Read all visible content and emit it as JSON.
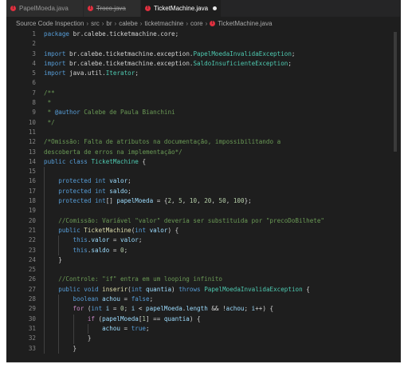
{
  "tabs": [
    {
      "label": "PapelMoeda.java",
      "active": false,
      "error": true,
      "deleted": false,
      "dirty": false
    },
    {
      "label": "Troco.java",
      "active": false,
      "error": true,
      "deleted": true,
      "dirty": false
    },
    {
      "label": "TicketMachine.java",
      "active": true,
      "error": true,
      "deleted": false,
      "dirty": true
    }
  ],
  "breadcrumb": [
    "Source Code Inspection",
    "src",
    "br",
    "calebe",
    "ticketmachine",
    "core",
    "TicketMachine.java"
  ],
  "colors": {
    "error": "#e0303f",
    "keyword": "#569cd6",
    "type": "#4ec9b0",
    "comment": "#6a9955",
    "number": "#b5cea8",
    "variable": "#9cdcfe"
  },
  "editor": {
    "lines": [
      {
        "n": "1",
        "i": 0,
        "t": [
          [
            "kw",
            "package "
          ],
          [
            "pl",
            "br.calebe.ticketmachine.core;"
          ]
        ]
      },
      {
        "n": "2",
        "i": 0,
        "t": []
      },
      {
        "n": "3",
        "i": 0,
        "t": [
          [
            "kw",
            "import "
          ],
          [
            "pl",
            "br.calebe.ticketmachine.exception."
          ],
          [
            "ty",
            "PapelMoedaInvalidaException"
          ],
          [
            "pl",
            ";"
          ]
        ]
      },
      {
        "n": "4",
        "i": 0,
        "t": [
          [
            "kw",
            "import "
          ],
          [
            "pl",
            "br.calebe.ticketmachine.exception."
          ],
          [
            "ty",
            "SaldoInsuficienteException"
          ],
          [
            "pl",
            ";"
          ]
        ]
      },
      {
        "n": "5",
        "i": 0,
        "t": [
          [
            "kw",
            "import "
          ],
          [
            "pl",
            "java.util."
          ],
          [
            "ty",
            "Iterator"
          ],
          [
            "pl",
            ";"
          ]
        ]
      },
      {
        "n": "6",
        "i": 0,
        "t": []
      },
      {
        "n": "7",
        "i": 0,
        "t": [
          [
            "cm",
            "/**"
          ]
        ]
      },
      {
        "n": "8",
        "i": 0,
        "t": [
          [
            "cm",
            " *"
          ]
        ]
      },
      {
        "n": "9",
        "i": 0,
        "t": [
          [
            "cm",
            " * "
          ],
          [
            "tag",
            "@author"
          ],
          [
            "cm",
            " Calebe de Paula Bianchini"
          ]
        ]
      },
      {
        "n": "10",
        "i": 0,
        "t": [
          [
            "cm",
            " */"
          ]
        ]
      },
      {
        "n": "11",
        "i": 0,
        "t": []
      },
      {
        "n": "12",
        "i": 0,
        "t": [
          [
            "cm",
            "/*Omissão: Falta de atributos na documentação, impossibilitando a"
          ]
        ]
      },
      {
        "n": "13",
        "i": 0,
        "t": [
          [
            "cm",
            "descoberta de erros na implementação*/"
          ]
        ]
      },
      {
        "n": "14",
        "i": 0,
        "t": [
          [
            "kw",
            "public class "
          ],
          [
            "ty",
            "TicketMachine"
          ],
          [
            "pl",
            " {"
          ]
        ]
      },
      {
        "n": "15",
        "i": 1,
        "t": []
      },
      {
        "n": "16",
        "i": 1,
        "t": [
          [
            "kw",
            "protected int "
          ],
          [
            "var",
            "valor"
          ],
          [
            "pl",
            ";"
          ]
        ]
      },
      {
        "n": "17",
        "i": 1,
        "t": [
          [
            "kw",
            "protected int "
          ],
          [
            "var",
            "saldo"
          ],
          [
            "pl",
            ";"
          ]
        ]
      },
      {
        "n": "18",
        "i": 1,
        "t": [
          [
            "kw",
            "protected int"
          ],
          [
            "pl",
            "[] "
          ],
          [
            "var",
            "papelMoeda"
          ],
          [
            "pl",
            " = {"
          ],
          [
            "num",
            "2"
          ],
          [
            "pl",
            ", "
          ],
          [
            "num",
            "5"
          ],
          [
            "pl",
            ", "
          ],
          [
            "num",
            "10"
          ],
          [
            "pl",
            ", "
          ],
          [
            "num",
            "20"
          ],
          [
            "pl",
            ", "
          ],
          [
            "num",
            "50"
          ],
          [
            "pl",
            ", "
          ],
          [
            "num",
            "100"
          ],
          [
            "pl",
            "};"
          ]
        ]
      },
      {
        "n": "19",
        "i": 1,
        "t": []
      },
      {
        "n": "20",
        "i": 1,
        "t": [
          [
            "cm",
            "//Comissão: Variável \"valor\" deveria ser substituida por \"precoDoBilhete\""
          ]
        ]
      },
      {
        "n": "21",
        "i": 1,
        "t": [
          [
            "kw",
            "public "
          ],
          [
            "fn",
            "TicketMachine"
          ],
          [
            "pl",
            "("
          ],
          [
            "kw",
            "int "
          ],
          [
            "var",
            "valor"
          ],
          [
            "pl",
            ") {"
          ]
        ]
      },
      {
        "n": "22",
        "i": 2,
        "t": [
          [
            "kw",
            "this"
          ],
          [
            "pl",
            "."
          ],
          [
            "var",
            "valor"
          ],
          [
            "pl",
            " = "
          ],
          [
            "var",
            "valor"
          ],
          [
            "pl",
            ";"
          ]
        ]
      },
      {
        "n": "23",
        "i": 2,
        "t": [
          [
            "kw",
            "this"
          ],
          [
            "pl",
            "."
          ],
          [
            "var",
            "saldo"
          ],
          [
            "pl",
            " = "
          ],
          [
            "num",
            "0"
          ],
          [
            "pl",
            ";"
          ]
        ]
      },
      {
        "n": "24",
        "i": 1,
        "t": [
          [
            "pl",
            "}"
          ]
        ]
      },
      {
        "n": "25",
        "i": 1,
        "t": []
      },
      {
        "n": "26",
        "i": 1,
        "t": [
          [
            "cm",
            "//Controle: \"if\" entra em um looping infinito"
          ]
        ]
      },
      {
        "n": "27",
        "i": 1,
        "t": [
          [
            "kw",
            "public void "
          ],
          [
            "fn",
            "inserir"
          ],
          [
            "pl",
            "("
          ],
          [
            "kw",
            "int "
          ],
          [
            "var",
            "quantia"
          ],
          [
            "pl",
            ") "
          ],
          [
            "kw",
            "throws "
          ],
          [
            "ty",
            "PapelMoedaInvalidaException"
          ],
          [
            "pl",
            " {"
          ]
        ]
      },
      {
        "n": "28",
        "i": 2,
        "t": [
          [
            "kw",
            "boolean "
          ],
          [
            "var",
            "achou"
          ],
          [
            "pl",
            " = "
          ],
          [
            "kw",
            "false"
          ],
          [
            "pl",
            ";"
          ]
        ]
      },
      {
        "n": "29",
        "i": 2,
        "t": [
          [
            "kw2",
            "for "
          ],
          [
            "pl",
            "("
          ],
          [
            "kw",
            "int "
          ],
          [
            "var",
            "i"
          ],
          [
            "pl",
            " = "
          ],
          [
            "num",
            "0"
          ],
          [
            "pl",
            "; "
          ],
          [
            "var",
            "i"
          ],
          [
            "pl",
            " < "
          ],
          [
            "var",
            "papelMoeda"
          ],
          [
            "pl",
            "."
          ],
          [
            "var",
            "length"
          ],
          [
            "pl",
            " && !"
          ],
          [
            "var",
            "achou"
          ],
          [
            "pl",
            "; "
          ],
          [
            "var",
            "i"
          ],
          [
            "pl",
            "++) {"
          ]
        ]
      },
      {
        "n": "30",
        "i": 3,
        "t": [
          [
            "kw2",
            "if "
          ],
          [
            "pl",
            "("
          ],
          [
            "var",
            "papelMoeda"
          ],
          [
            "pl",
            "["
          ],
          [
            "num",
            "1"
          ],
          [
            "pl",
            "] == "
          ],
          [
            "var",
            "quantia"
          ],
          [
            "pl",
            ") {"
          ]
        ]
      },
      {
        "n": "31",
        "i": 4,
        "t": [
          [
            "var",
            "achou"
          ],
          [
            "pl",
            " = "
          ],
          [
            "kw",
            "true"
          ],
          [
            "pl",
            ";"
          ]
        ]
      },
      {
        "n": "32",
        "i": 3,
        "t": [
          [
            "pl",
            "}"
          ]
        ]
      },
      {
        "n": "33",
        "i": 2,
        "t": [
          [
            "pl",
            "}"
          ]
        ]
      }
    ]
  }
}
